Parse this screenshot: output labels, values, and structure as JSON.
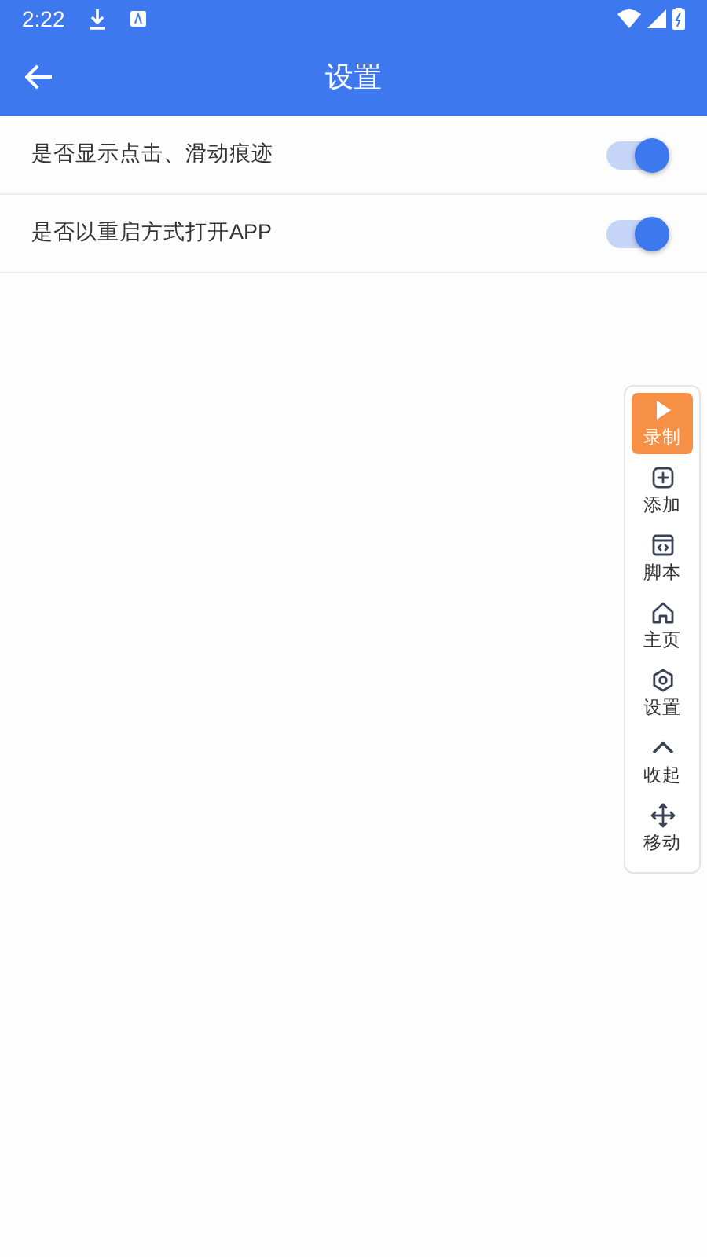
{
  "status_bar": {
    "time": "2:22"
  },
  "app_bar": {
    "title": "设置"
  },
  "settings": [
    {
      "label": "是否显示点击、滑动痕迹",
      "on": true
    },
    {
      "label": "是否以重启方式打开APP",
      "on": true
    }
  ],
  "float_toolbar": [
    {
      "label": "录制",
      "selected": true
    },
    {
      "label": "添加",
      "selected": false
    },
    {
      "label": "脚本",
      "selected": false
    },
    {
      "label": "主页",
      "selected": false
    },
    {
      "label": "设置",
      "selected": false
    },
    {
      "label": "收起",
      "selected": false
    },
    {
      "label": "移动",
      "selected": false
    }
  ]
}
